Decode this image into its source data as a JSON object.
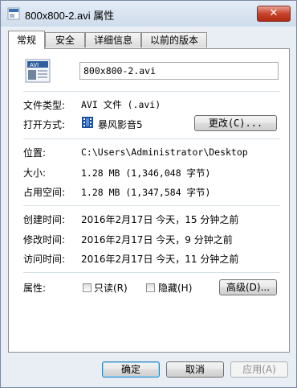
{
  "window": {
    "title": "800x800-2.avi 属性",
    "close_label": "✕"
  },
  "tabs": [
    {
      "label": "常规"
    },
    {
      "label": "安全"
    },
    {
      "label": "详细信息"
    },
    {
      "label": "以前的版本"
    }
  ],
  "general": {
    "file_name": "800x800-2.avi",
    "file_type_label": "文件类型:",
    "file_type_value": "AVI 文件 (.avi)",
    "open_with_label": "打开方式:",
    "open_with_value": "暴风影音5",
    "change_button": "更改(C)...",
    "location_label": "位置:",
    "location_value": "C:\\Users\\Administrator\\Desktop",
    "size_label": "大小:",
    "size_value": "1.28 MB (1,346,048 字节)",
    "size_on_disk_label": "占用空间:",
    "size_on_disk_value": "1.28 MB (1,347,584 字节)",
    "created_label": "创建时间:",
    "created_value": "2016年2月17日 今天，15 分钟之前",
    "modified_label": "修改时间:",
    "modified_value": "2016年2月17日 今天，9 分钟之前",
    "accessed_label": "访问时间:",
    "accessed_value": "2016年2月17日 今天，11 分钟之前",
    "attributes_label": "属性:",
    "readonly_label": "只读(R)",
    "readonly_checked": false,
    "hidden_label": "隐藏(H)",
    "hidden_checked": false,
    "advanced_button": "高级(D)...",
    "file_icon_badge": "AVI"
  },
  "footer": {
    "ok_button": "确定",
    "cancel_button": "取消",
    "apply_button": "应用(A)"
  }
}
